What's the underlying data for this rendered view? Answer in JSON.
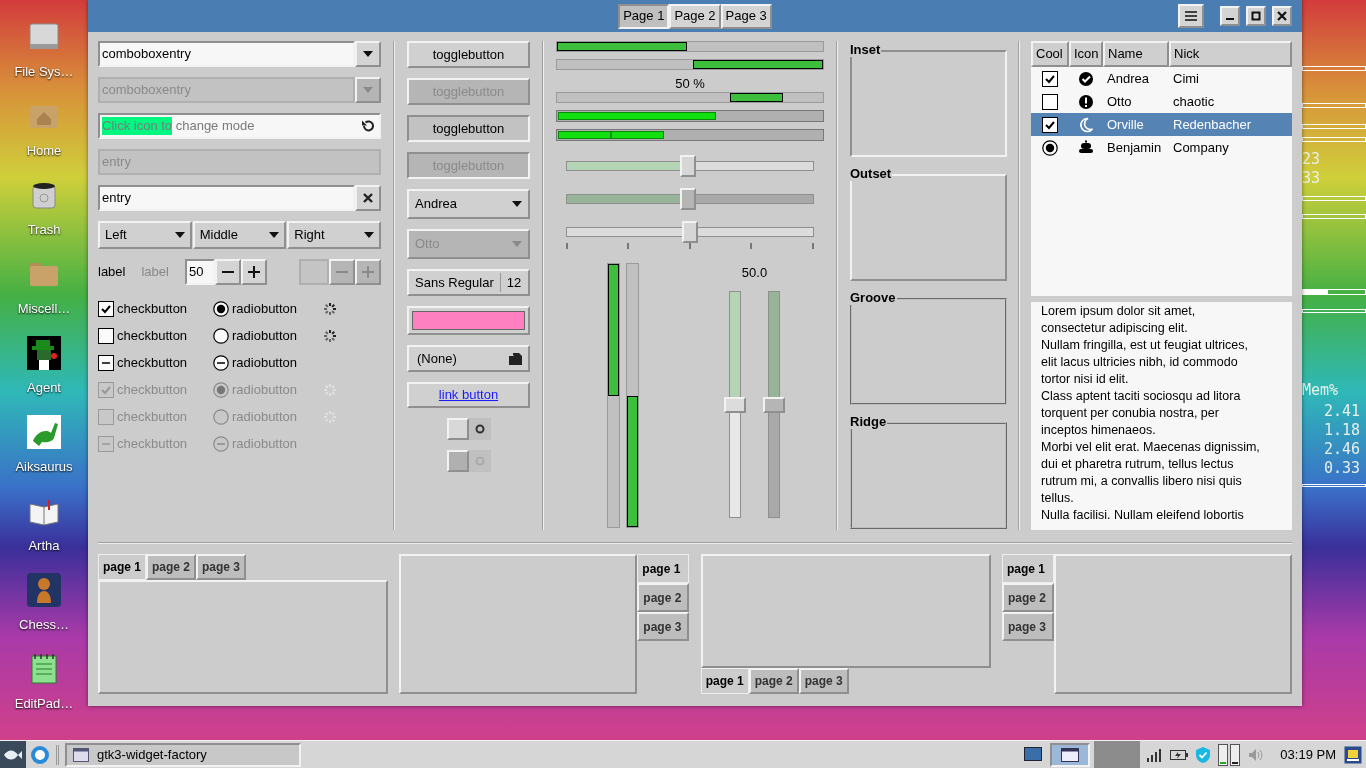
{
  "desktop_icons": [
    {
      "kind": "drive",
      "label": "File Sys…"
    },
    {
      "kind": "home",
      "label": "Home"
    },
    {
      "kind": "trash",
      "label": "Trash"
    },
    {
      "kind": "folder",
      "label": "Miscell…"
    },
    {
      "kind": "agent",
      "label": "Agent"
    },
    {
      "kind": "dino",
      "label": "Aiksaurus"
    },
    {
      "kind": "book",
      "label": "Artha"
    },
    {
      "kind": "chess",
      "label": "Chess…"
    },
    {
      "kind": "notepad",
      "label": "EditPad…"
    }
  ],
  "conky": {
    "numbers": [
      "23",
      "33"
    ],
    "mem_header": "Mem%",
    "mem_values": [
      "2.41",
      "1.18",
      "2.46",
      "0.33"
    ]
  },
  "stack_tabs": [
    {
      "label": "Page 1",
      "selected": true
    },
    {
      "label": "Page 2",
      "selected": false
    },
    {
      "label": "Page 3",
      "selected": false
    }
  ],
  "combo_entries": [
    {
      "value": "comboboxentry",
      "disabled": false
    },
    {
      "value": "comboboxentry",
      "disabled": true
    }
  ],
  "mode_entry": {
    "placeholder": "Click icon to change mode",
    "level": 0.25
  },
  "entries": [
    {
      "value": "entry",
      "disabled": true,
      "kind": "plain"
    },
    {
      "value": "entry",
      "disabled": false,
      "kind": "clearable"
    }
  ],
  "linked_combos": [
    {
      "label": "Left"
    },
    {
      "label": "Middle"
    },
    {
      "label": "Right"
    }
  ],
  "labels": [
    {
      "text": "label",
      "disabled": false
    },
    {
      "text": "label",
      "disabled": true
    }
  ],
  "spin_buttons": [
    {
      "value": "50",
      "disabled": false
    },
    {
      "disabled": true
    }
  ],
  "check_rows": [
    {
      "disabled": false,
      "check": {
        "label": "checkbutton",
        "checked": true,
        "inconsistent": false
      },
      "radio": {
        "label": "radiobutton",
        "checked": true,
        "inconsistent": false
      },
      "spinner": true
    },
    {
      "disabled": false,
      "check": {
        "label": "checkbutton",
        "checked": false,
        "inconsistent": false
      },
      "radio": {
        "label": "radiobutton",
        "checked": false,
        "inconsistent": false
      },
      "spinner": true
    },
    {
      "disabled": false,
      "check": {
        "label": "checkbutton",
        "inconsistent": true
      },
      "radio": {
        "label": "radiobutton",
        "inconsistent": true
      },
      "spinner": false
    },
    {
      "disabled": true,
      "check": {
        "label": "checkbutton",
        "checked": true,
        "inconsistent": false
      },
      "radio": {
        "label": "radiobutton",
        "checked": true,
        "inconsistent": false
      },
      "spinner": true
    },
    {
      "disabled": true,
      "check": {
        "label": "checkbutton",
        "checked": false,
        "inconsistent": false
      },
      "radio": {
        "label": "radiobutton",
        "checked": false,
        "inconsistent": false
      },
      "spinner": true
    },
    {
      "disabled": true,
      "check": {
        "label": "checkbutton",
        "inconsistent": true
      },
      "radio": {
        "label": "radiobutton",
        "inconsistent": true
      },
      "spinner": false
    }
  ],
  "toggle_buttons": [
    {
      "label": "togglebutton",
      "active": false,
      "disabled": false
    },
    {
      "label": "togglebutton",
      "active": false,
      "disabled": true
    },
    {
      "label": "togglebutton",
      "active": true,
      "disabled": false
    },
    {
      "label": "togglebutton",
      "active": true,
      "disabled": true
    }
  ],
  "combo_boxes": [
    {
      "value": "Andrea",
      "disabled": false
    },
    {
      "value": "Otto",
      "disabled": true
    }
  ],
  "font_button": {
    "family": "Sans Regular",
    "size": "12"
  },
  "color_button": {
    "color": "#ff80c0"
  },
  "file_button": {
    "value": "(None)"
  },
  "link_button": {
    "label": "link button"
  },
  "switches": [
    {
      "on": false,
      "disabled": false
    },
    {
      "on": false,
      "disabled": true
    }
  ],
  "progress_bars": [
    {
      "kind": "from-start",
      "level": 0.49
    },
    {
      "kind": "from-end",
      "level": 0.49
    },
    {
      "kind": "pulse",
      "text": "50 %"
    }
  ],
  "level_bars": [
    {
      "kind": "continuous",
      "level": 0.6
    },
    {
      "kind": "discrete",
      "level": 0.4
    }
  ],
  "hscales": [
    {
      "level": 0.49,
      "disabled": false,
      "fill": true,
      "marks": false
    },
    {
      "level": 0.49,
      "disabled": true,
      "fill": true,
      "marks": false
    },
    {
      "level": 0.5,
      "disabled": false,
      "fill": false,
      "marks": true
    }
  ],
  "vprogress": [
    {
      "kind": "from-start",
      "level": 0.5
    },
    {
      "kind": "from-end",
      "level": 0.5
    }
  ],
  "vscale_value": "50.0",
  "vscales": [
    {
      "level": 0.5,
      "disabled": false
    },
    {
      "level": 0.5,
      "disabled": true
    }
  ],
  "frames": [
    {
      "kind": "inset",
      "label": "Inset"
    },
    {
      "kind": "outset",
      "label": "Outset"
    },
    {
      "kind": "groove",
      "label": "Groove"
    },
    {
      "kind": "ridge",
      "label": "Ridge"
    }
  ],
  "tree": {
    "columns": [
      "Cool",
      "Icon",
      "Name",
      "Nick"
    ],
    "rows": [
      {
        "cool": {
          "kind": "check",
          "checked": true
        },
        "icon": {
          "kind": "check-circle"
        },
        "name": "Andrea",
        "nick": "Cimi",
        "selected": false
      },
      {
        "cool": {
          "kind": "check",
          "checked": false
        },
        "icon": {
          "kind": "alert"
        },
        "name": "Otto",
        "nick": "chaotic",
        "selected": false
      },
      {
        "cool": {
          "kind": "check",
          "checked": true
        },
        "icon": {
          "kind": "moon"
        },
        "name": "Orville",
        "nick": "Redenbacher",
        "selected": true
      },
      {
        "cool": {
          "kind": "radio",
          "checked": true
        },
        "icon": {
          "kind": "bot"
        },
        "name": "Benjamin",
        "nick": "Company",
        "selected": false
      }
    ]
  },
  "text_view": {
    "lines": [
      "Lorem ipsum dolor sit amet,",
      "consectetur adipiscing elit.",
      "Nullam fringilla, est ut feugiat ultrices,",
      "elit lacus ultricies nibh, id commodo",
      "tortor nisi id elit.",
      "Class aptent taciti sociosqu ad litora",
      "torquent per conubia nostra, per",
      "inceptos himenaeos.",
      "Morbi vel elit erat. Maecenas dignissim,",
      "dui et pharetra rutrum, tellus lectus",
      "rutrum mi, a convallis libero nisi quis",
      "tellus.",
      "Nulla facilisi. Nullam eleifend lobortis"
    ]
  },
  "notebooks": [
    {
      "kind": "top",
      "tabs": [
        {
          "label": "page 1",
          "selected": true
        },
        {
          "label": "page 2",
          "selected": false
        },
        {
          "label": "page 3",
          "selected": false
        }
      ]
    },
    {
      "kind": "right",
      "tabs": [
        {
          "label": "page 1",
          "selected": true
        },
        {
          "label": "page 2",
          "selected": false
        },
        {
          "label": "page 3",
          "selected": false
        }
      ]
    },
    {
      "kind": "bottom",
      "tabs": [
        {
          "label": "page 1",
          "selected": true
        },
        {
          "label": "page 2",
          "selected": false
        },
        {
          "label": "page 3",
          "selected": false
        }
      ]
    },
    {
      "kind": "left",
      "tabs": [
        {
          "label": "page 1",
          "selected": true
        },
        {
          "label": "page 2",
          "selected": false
        },
        {
          "label": "page 3",
          "selected": false
        }
      ]
    }
  ],
  "taskbar": {
    "task": "gtk3-widget-factory",
    "clock": "03:19 PM"
  }
}
